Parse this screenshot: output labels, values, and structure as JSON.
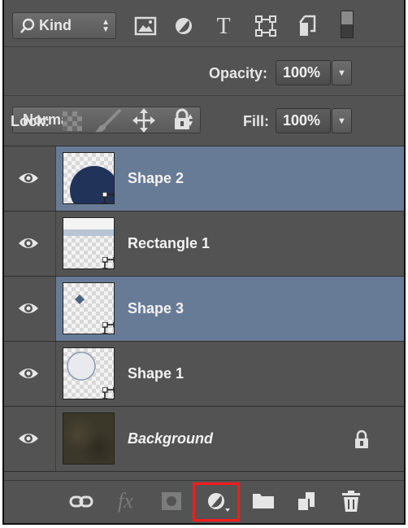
{
  "filter_bar": {
    "kind_label": "Kind",
    "icons": [
      "image-filter-icon",
      "adjustment-filter-icon",
      "type-filter-icon",
      "shape-filter-icon",
      "smart-object-filter-icon",
      "filter-toggle-icon"
    ]
  },
  "blend": {
    "mode": "Normal",
    "opacity_label": "Opacity:",
    "opacity_value": "100%"
  },
  "lock_bar": {
    "lock_label": "Lock:",
    "fill_label": "Fill:",
    "fill_value": "100%"
  },
  "layers": [
    {
      "name": "Shape 2",
      "selected": true,
      "thumb": "shape-2-thumbnail"
    },
    {
      "name": "Rectangle 1",
      "selected": false,
      "thumb": "rectangle-1-thumbnail"
    },
    {
      "name": "Shape 3",
      "selected": true,
      "thumb": "shape-3-thumbnail"
    },
    {
      "name": "Shape 1",
      "selected": false,
      "thumb": "shape-1-thumbnail"
    },
    {
      "name": "Background",
      "selected": false,
      "locked": true,
      "thumb": "background-thumbnail"
    }
  ],
  "bottom_bar": {
    "fx_label": "fx",
    "icons": [
      "link-layers-icon",
      "layer-style-icon",
      "add-mask-icon",
      "new-adjustment-layer-icon",
      "new-group-icon",
      "new-layer-icon",
      "delete-layer-icon"
    ],
    "highlighted": "new-adjustment-layer-icon"
  },
  "colors": {
    "panel_bg": "#535353",
    "selected_row": "#687b96",
    "highlight": "#ff1a1a"
  }
}
